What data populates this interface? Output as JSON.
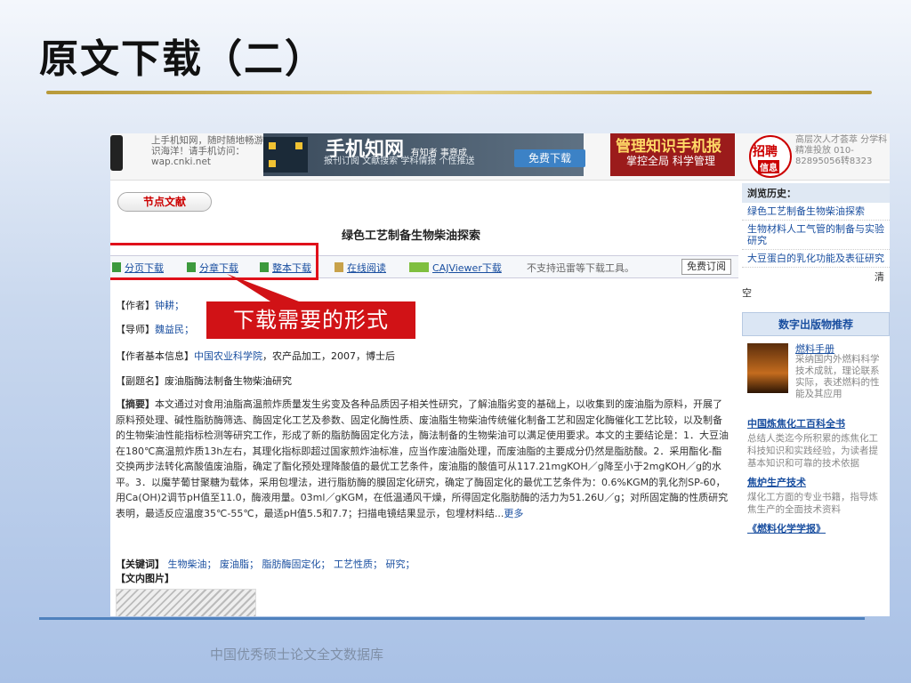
{
  "slide": {
    "title": "原文下载（二）",
    "callout": "下载需要的形式",
    "footer": "中国优秀硕士论文全文数据库"
  },
  "banner": {
    "phone_text": "上手机知网，随时随地畅游知识海洋！请手机访问：wap.cnki.net",
    "ad1_big": "手机知网",
    "ad1_slogan": "有知者 事竟成",
    "ad1_small": "报刊订阅 文献搜索 学科情报 个性推送",
    "ad1_button": "免费下载",
    "ad2_big": "管理知识手机报",
    "ad2_small": "掌控全局 科学管理",
    "hire_a": "招聘",
    "hire_b": "信息",
    "hire_text": "高层次人才荟萃 分学科精准投放 010-82895056转8323"
  },
  "page": {
    "pill": "节点文献",
    "paper_title": "绿色工艺制备生物柴油探索",
    "downloads": [
      "分页下载",
      "分章下载",
      "整本下载",
      "在线阅读",
      "CAJViewer下载"
    ],
    "download_note": "不支持迅雷等下载工具。",
    "subscribe": "免费订阅",
    "author_label": "【作者】",
    "author": "钟耕；",
    "advisor_label": "【导师】",
    "advisor": "魏益民；",
    "info_label": "【作者基本信息】",
    "info_link": "中国农业科学院",
    "info_rest": "，农产品加工，2007，博士后",
    "subtitle_label": "【副题名】",
    "subtitle": "废油脂酶法制备生物柴油研究",
    "abstract_label": "【摘要】",
    "abstract": "本文通过对食用油脂高温煎炸质量发生劣变及各种品质因子相关性研究，了解油脂劣变的基础上，以收集到的废油脂为原料，开展了原料预处理、碱性脂肪酶筛选、酶固定化工艺及参数、固定化酶性质、废油脂生物柴油传统催化制备工艺和固定化酶催化工艺比较，以及制备的生物柴油性能指标检测等研究工作，形成了新的脂肪酶固定化方法，酶法制备的生物柴油可以满足使用要求。本文的主要结论是：1．大豆油在180℃高温煎炸质13h左右，其理化指标即超过国家煎炸油标准，应当作废油脂处理，而废油脂的主要成分仍然是脂肪酸。2．采用酯化-酯交换两步法转化高酸值废油脂，确定了酯化预处理降酸值的最优工艺条件，废油脂的酸值可从117.21mgKOH／g降至小于2mgKOH／g的水平。3．以魔芋葡甘聚糖为载体，采用包埋法，进行脂肪酶的膜固定化研究，确定了酶固定化的最优工艺条件为：0.6%KGM的乳化剂SP-60，用Ca(OH)2调节pH值至11.0，酶液用量。03ml／gKGM，在低温通风干燥，所得固定化脂肪酶的活力为51.26U／g；对所固定酶的性质研究表明，最适反应温度35℃-55℃，最适pH值5.5和7.7；扫描电镜结果显示，包埋材料结...",
    "more": "更多",
    "kw_label": "【关键词】",
    "keywords": [
      "生物柴油；",
      "废油脂；",
      "脂肪酶固定化；",
      "工艺性质；",
      "研究；"
    ],
    "figures_label": "【文内图片】"
  },
  "sidebar": {
    "history_title": "浏览历史：",
    "history": [
      "绿色工艺制备生物柴油探索",
      "生物材料人工气管的制备与实验研究",
      "大豆蛋白的乳化功能及表征研究"
    ],
    "clear": "清",
    "clear2": "空",
    "rec_title": "数字出版物推荐",
    "book1_title": "燃料手册",
    "book1_desc": "采纳国内外燃料科学技术成就，理论联系实际，表述燃料的性能及其应用",
    "rec": [
      {
        "title": "中国炼焦化工百科全书",
        "desc": "总结人类迄今所积累的炼焦化工科技知识和实践经验，为读者提基本知识和可靠的技术依据"
      },
      {
        "title": "焦炉生产技术",
        "desc": "煤化工方面的专业书籍，指导炼焦生产的全面技术资料"
      },
      {
        "title": "《燃料化学学报》",
        "desc": ""
      }
    ]
  },
  "colors": {
    "accent_red": "#e0101a",
    "link_blue": "#1a4fa0",
    "rule_gold": "#c9ac4c",
    "rule_blue": "#4f81bd"
  }
}
